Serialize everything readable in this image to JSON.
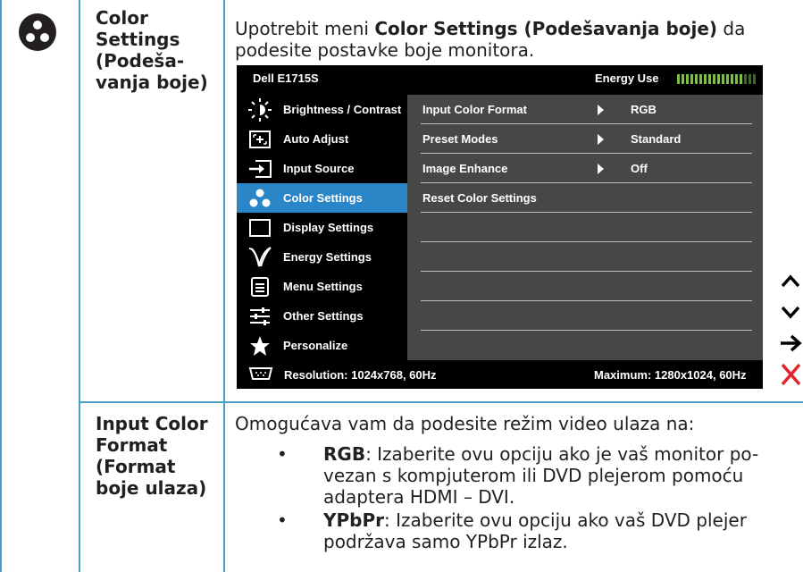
{
  "rows": [
    {
      "icon": "color-settings-icon",
      "term": "Color Settings (Podeša-vanja boje)",
      "term_lines": [
        "Color",
        "Settings",
        "(Podeša-",
        "vanja boje)"
      ],
      "description_pre": "Upotrebit meni ",
      "description_bold": "Color Settings (Podešavanja boje)",
      "description_post": " da podesite postavke boje monitora."
    },
    {
      "term_lines": [
        "Input Color",
        "Format",
        "(Format",
        "boje ulaza)"
      ],
      "description": "Omogućava vam da podesite režim video ulaza na:",
      "bullets": [
        {
          "symbol": "•",
          "key": "RGB",
          "text_lines": [
            ": Izaberite ovu opciju ako je vaš monitor po-",
            "vezan s kompjuterom ili DVD plejerom pomoću",
            "adaptera HDMI – DVI."
          ]
        },
        {
          "symbol": "•",
          "key": "YPbPr",
          "text_lines": [
            ": Izaberite ovu opciju ako vaš DVD plejer",
            "podržava samo YPbPr izlaz."
          ]
        }
      ]
    }
  ],
  "osd": {
    "model": "Dell E1715S",
    "energy_label": "Energy Use",
    "energy_level": 0.82,
    "menu": [
      {
        "label": "Brightness / Contrast",
        "icon": "brightness-icon",
        "active": false
      },
      {
        "label": "Auto Adjust",
        "icon": "auto-adjust-icon",
        "active": false
      },
      {
        "label": "Input Source",
        "icon": "input-source-icon",
        "active": false
      },
      {
        "label": "Color Settings",
        "icon": "color-settings-icon",
        "active": true
      },
      {
        "label": "Display Settings",
        "icon": "display-settings-icon",
        "active": false
      },
      {
        "label": "Energy Settings",
        "icon": "energy-settings-icon",
        "active": false
      },
      {
        "label": "Menu Settings",
        "icon": "menu-settings-icon",
        "active": false
      },
      {
        "label": "Other Settings",
        "icon": "other-settings-icon",
        "active": false
      },
      {
        "label": "Personalize",
        "icon": "star-icon",
        "active": false
      }
    ],
    "submenu": [
      {
        "name": "Input Color Format",
        "value": "RGB",
        "has_arrow": true
      },
      {
        "name": "Preset Modes",
        "value": "Standard",
        "has_arrow": true
      },
      {
        "name": "Image Enhance",
        "value": "Off",
        "has_arrow": true
      },
      {
        "name": "Reset Color Settings",
        "value": "",
        "has_arrow": false
      },
      {
        "name": "",
        "value": "",
        "has_arrow": false
      },
      {
        "name": "",
        "value": "",
        "has_arrow": false
      },
      {
        "name": "",
        "value": "",
        "has_arrow": false
      },
      {
        "name": "",
        "value": "",
        "has_arrow": false
      },
      {
        "name": "",
        "value": "",
        "has_arrow": false
      }
    ],
    "resolution": "Resolution: 1024x768, 60Hz",
    "maximum": "Maximum: 1280x1024, 60Hz"
  },
  "nav_buttons": [
    "up-chevron-icon",
    "down-chevron-icon",
    "enter-arrow-icon",
    "close-icon"
  ],
  "colors": {
    "grid": "#4a9fc6",
    "osd_highlight": "#2a86c6",
    "osd_panel": "#474747",
    "energy_meter": "#7dc142",
    "close_red": "#e3242b"
  }
}
